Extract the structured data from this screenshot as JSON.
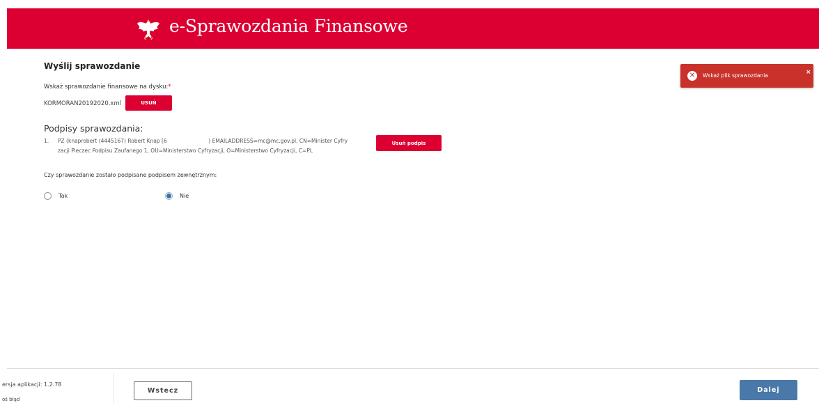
{
  "header": {
    "title": "e-Sprawozdania Finansowe",
    "logo_icon": "polish-eagle-emblem",
    "background": "#dc0032"
  },
  "main": {
    "heading": "Wyślij sprawozdanie",
    "file_label": "Wskaż sprawozdanie finansowe na dysku:",
    "required_marker": "*",
    "file_name": "KORMORAN20192020.xml",
    "remove_file_label": "USUŃ",
    "signatures_heading": "Podpisy sprawozdania:",
    "signatures": [
      {
        "number": "1.",
        "line1": "PZ (knaprobert (4445167) Robert Knap [6                         ) EMAILADDRESS=mc@mc.gov.pl, CN=Minister Cyfry",
        "line2": "zacji Pieczec Podpisu Zaufanego 1, OU=Ministerstwo Cyfryzacji, O=Ministerstwo Cyfryzacji, C=PL"
      }
    ],
    "remove_signature_label": "Usuń podpis",
    "external_signature_question": "Czy sprawozdanie zostało podpisane podpisem zewnętrznym:",
    "radio_options": [
      {
        "label": "Tak",
        "checked": false
      },
      {
        "label": "Nie",
        "checked": true
      }
    ]
  },
  "toast": {
    "message": "Wskaż plik sprawozdania",
    "icon": "error-x-circle-icon",
    "close_symbol": "×",
    "background": "#c8322a"
  },
  "footer": {
    "version_text": "ersja aplikacji: 1.2.78",
    "report_text": "oś błąd",
    "back_label": "Wstecz",
    "next_label": "Dalej",
    "next_color": "#4a78a9"
  }
}
